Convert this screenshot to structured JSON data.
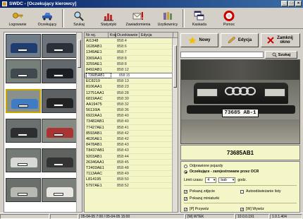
{
  "window": {
    "title": "SWDC - [Oczekujący kierowcy]"
  },
  "toolbar": [
    {
      "label": "Logowanie",
      "icon": "key-icon"
    },
    {
      "label": "Oczekujący",
      "icon": "car-icon"
    },
    {
      "label": "Szukaj",
      "icon": "search-icon"
    },
    {
      "label": "Statystyki",
      "icon": "chart-icon"
    },
    {
      "label": "Zawiadomienia",
      "icon": "envelope-icon"
    },
    {
      "label": "Uzytkownicy",
      "icon": "users-icon"
    },
    {
      "label": "Kaskada",
      "icon": "cascade-icon"
    },
    {
      "label": "Pomoc",
      "icon": "lifebuoy-icon"
    }
  ],
  "table": {
    "headers": [
      "Nr rej.",
      "Kraj",
      "Oczekiwanie",
      "Edycja"
    ],
    "rows": [
      [
        "AI1348",
        "",
        "858:4",
        ""
      ],
      [
        "1628AB1",
        "",
        "858:6",
        ""
      ],
      [
        "1349AE1",
        "",
        "858:7",
        ""
      ],
      [
        "3369AA1",
        "",
        "858:8",
        ""
      ],
      [
        "3259AE1",
        "",
        "858:8",
        ""
      ],
      [
        "8492AB1",
        "",
        "858:12",
        ""
      ],
      [
        "73685AB1",
        "",
        "858:15",
        ""
      ],
      [
        "EC8219",
        "",
        "858:13",
        ""
      ],
      [
        "8106AA1",
        "",
        "858:23",
        ""
      ],
      [
        "12751AA1",
        "",
        "858:28",
        ""
      ],
      [
        "6819AAC",
        "",
        "858:30",
        ""
      ],
      [
        "AA19475",
        "",
        "858:32",
        ""
      ],
      [
        "56116IA",
        "",
        "858:36",
        ""
      ],
      [
        "6922AA1",
        "",
        "858:40",
        ""
      ],
      [
        "73482AB1",
        "",
        "858:40",
        ""
      ],
      [
        "77427AE1",
        "",
        "858:41",
        ""
      ],
      [
        "8593AB1",
        "",
        "858:42",
        ""
      ],
      [
        "4626AE1",
        "",
        "858:42",
        ""
      ],
      [
        "8478AB1",
        "",
        "858:43",
        ""
      ],
      [
        "T8437AB1",
        "",
        "858:43",
        ""
      ],
      [
        "9203AB1",
        "",
        "858:44",
        ""
      ],
      [
        "26346AA1",
        "",
        "858:45",
        ""
      ],
      [
        "T2403AE1",
        "",
        "858:48",
        ""
      ],
      [
        "7113AAC",
        "",
        "858:49",
        ""
      ],
      [
        "L814195",
        "",
        "858:50",
        ""
      ],
      [
        "5797AE1",
        "",
        "858:52",
        ""
      ]
    ],
    "selected_row": 6
  },
  "buttons": {
    "new": "Nowy",
    "edit": "Edycja",
    "close": "Zamknij okno",
    "search": "Szukaj"
  },
  "plate": {
    "number": "73685AB1",
    "photo_text": "73685 AB-1"
  },
  "options": {
    "radio1": "Odprawione pojazdy",
    "radio2": "Oczekujące - zarejestrowane przez OCR",
    "limit_label": "Limit czasu:",
    "limit_value": "4",
    "limit_unit_value": "bab",
    "limit_suffix": "godz.",
    "check1": "Pokazuj zdjęcie",
    "check2": "Pokazuj miniaturki",
    "check3": "Autoodświeżanie listy",
    "check4": "[P] Przywóz",
    "check5": "[W] Wywóz"
  },
  "status": {
    "datetime": "05-04-05 7:00 / 05-04-05 15:00",
    "mode": "[W] WTEK",
    "code": "10.0.0.191",
    "version": "1.0.1.404"
  },
  "colors": {
    "title_bar": "#0a246a",
    "table_bg": "#f4f6c8",
    "window_bg": "#d4d0c8"
  }
}
